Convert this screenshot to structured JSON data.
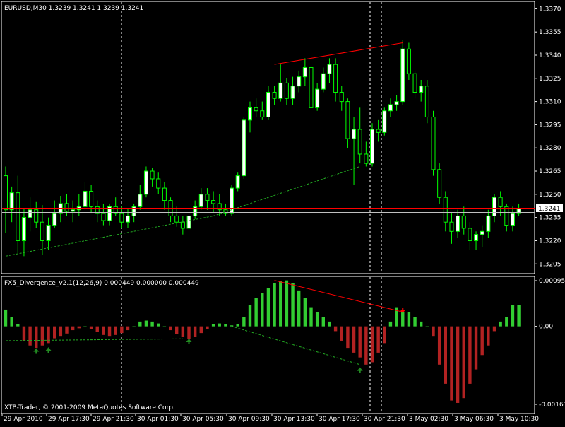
{
  "main_label": "EURUSD,M30  1.3239 1.3241 1.3239 1.3241",
  "indicator_label": "FX5_Divergence_v2.1(12,26,9) 0.000449 0.000000 0.000449",
  "copyright": "XTB-Trader, © 2001-2009 MetaQuotes Software Corp.",
  "current_price_label": "1.3241",
  "colors": {
    "background": "#000000",
    "frame": "#ffffff",
    "bull_candle": "#ffffff",
    "bear_candle": "#000000",
    "wick": "#00ff00",
    "price_line": "#ff0000",
    "hist_up": "#32cd32",
    "hist_down": "#b22222",
    "divergence_line_bear": "#ff0000",
    "divergence_line_bull": "#22aa22",
    "arrow_up": "#228b22",
    "arrow_down": "#ff0000",
    "text": "#ffffff"
  },
  "chart_data": [
    {
      "type": "candlestick",
      "symbol": "EURUSD",
      "timeframe": "M30",
      "ylim": [
        1.3201,
        1.3372
      ],
      "y_ticks": [
        "1.3370",
        "1.3355",
        "1.3340",
        "1.3325",
        "1.3310",
        "1.3295",
        "1.3280",
        "1.3265",
        "1.3250",
        "1.3235",
        "1.3220",
        "1.3205"
      ],
      "x_ticks": [
        "29 Apr 2010",
        "29 Apr 17:30",
        "29 Apr 21:30",
        "30 Apr 01:30",
        "30 Apr 05:30",
        "30 Apr 09:30",
        "30 Apr 13:30",
        "30 Apr 17:30",
        "30 Apr 21:30",
        "3 May 02:30",
        "3 May 06:30",
        "3 May 10:30"
      ],
      "current_price": 1.3241,
      "ohlc": [
        [
          1.3262,
          1.3268,
          1.3225,
          1.324
        ],
        [
          1.324,
          1.3255,
          1.3232,
          1.3251
        ],
        [
          1.3251,
          1.3262,
          1.3212,
          1.322
        ],
        [
          1.322,
          1.3241,
          1.321,
          1.3235
        ],
        [
          1.3235,
          1.3248,
          1.3226,
          1.324
        ],
        [
          1.324,
          1.3245,
          1.3228,
          1.3232
        ],
        [
          1.3232,
          1.3243,
          1.3211,
          1.322
        ],
        [
          1.322,
          1.3235,
          1.3214,
          1.323
        ],
        [
          1.323,
          1.3246,
          1.3228,
          1.3238
        ],
        [
          1.3238,
          1.3249,
          1.3232,
          1.3244
        ],
        [
          1.3244,
          1.325,
          1.3236,
          1.3239
        ],
        [
          1.3239,
          1.3246,
          1.3232,
          1.324
        ],
        [
          1.324,
          1.325,
          1.3236,
          1.3242
        ],
        [
          1.3242,
          1.3258,
          1.324,
          1.3252
        ],
        [
          1.3252,
          1.3256,
          1.3238,
          1.3242
        ],
        [
          1.3242,
          1.3246,
          1.3232,
          1.3238
        ],
        [
          1.3238,
          1.3244,
          1.323,
          1.3233
        ],
        [
          1.3233,
          1.3244,
          1.323,
          1.3242
        ],
        [
          1.3242,
          1.3248,
          1.3236,
          1.3238
        ],
        [
          1.3238,
          1.3242,
          1.3228,
          1.3232
        ],
        [
          1.3232,
          1.3241,
          1.3228,
          1.3236
        ],
        [
          1.3236,
          1.3244,
          1.3232,
          1.3242
        ],
        [
          1.3242,
          1.3256,
          1.324,
          1.325
        ],
        [
          1.325,
          1.3268,
          1.3248,
          1.3265
        ],
        [
          1.3265,
          1.3267,
          1.3255,
          1.326
        ],
        [
          1.326,
          1.3264,
          1.325,
          1.3254
        ],
        [
          1.3254,
          1.3258,
          1.324,
          1.3246
        ],
        [
          1.3246,
          1.3248,
          1.3232,
          1.3236
        ],
        [
          1.3236,
          1.3242,
          1.3229,
          1.3232
        ],
        [
          1.3232,
          1.3236,
          1.3224,
          1.3228
        ],
        [
          1.3228,
          1.3238,
          1.3226,
          1.3236
        ],
        [
          1.3236,
          1.3246,
          1.3234,
          1.3242
        ],
        [
          1.3242,
          1.3254,
          1.324,
          1.325
        ],
        [
          1.325,
          1.3254,
          1.324,
          1.3246
        ],
        [
          1.3246,
          1.3252,
          1.3238,
          1.3244
        ],
        [
          1.3244,
          1.325,
          1.3236,
          1.324
        ],
        [
          1.324,
          1.3244,
          1.3236,
          1.3238
        ],
        [
          1.3238,
          1.3256,
          1.3236,
          1.3254
        ],
        [
          1.3254,
          1.3264,
          1.3252,
          1.3262
        ],
        [
          1.3262,
          1.33,
          1.326,
          1.3298
        ],
        [
          1.3298,
          1.331,
          1.329,
          1.3306
        ],
        [
          1.3306,
          1.3312,
          1.33,
          1.3304
        ],
        [
          1.3304,
          1.331,
          1.3298,
          1.33
        ],
        [
          1.33,
          1.332,
          1.3298,
          1.3316
        ],
        [
          1.3316,
          1.332,
          1.3308,
          1.3312
        ],
        [
          1.3312,
          1.3334,
          1.331,
          1.3322
        ],
        [
          1.3322,
          1.3325,
          1.3308,
          1.3312
        ],
        [
          1.3312,
          1.3326,
          1.3308,
          1.332
        ],
        [
          1.332,
          1.333,
          1.3316,
          1.3326
        ],
        [
          1.3326,
          1.3338,
          1.332,
          1.3332
        ],
        [
          1.3332,
          1.3336,
          1.33,
          1.3306
        ],
        [
          1.3306,
          1.3322,
          1.3304,
          1.3318
        ],
        [
          1.3318,
          1.3332,
          1.3316,
          1.3328
        ],
        [
          1.3328,
          1.3338,
          1.3322,
          1.3334
        ],
        [
          1.3334,
          1.3338,
          1.331,
          1.3316
        ],
        [
          1.3316,
          1.332,
          1.3304,
          1.331
        ],
        [
          1.331,
          1.3312,
          1.328,
          1.3286
        ],
        [
          1.3286,
          1.33,
          1.3256,
          1.3292
        ],
        [
          1.3292,
          1.3306,
          1.327,
          1.3276
        ],
        [
          1.3276,
          1.3284,
          1.3268,
          1.327
        ],
        [
          1.327,
          1.3296,
          1.3268,
          1.3292
        ],
        [
          1.3292,
          1.3298,
          1.3284,
          1.329
        ],
        [
          1.329,
          1.3306,
          1.3288,
          1.3304
        ],
        [
          1.3304,
          1.3312,
          1.33,
          1.3308
        ],
        [
          1.3308,
          1.3314,
          1.3304,
          1.331
        ],
        [
          1.331,
          1.335,
          1.3308,
          1.3344
        ],
        [
          1.3344,
          1.3348,
          1.3324,
          1.3328
        ],
        [
          1.3328,
          1.333,
          1.3312,
          1.3316
        ],
        [
          1.3316,
          1.3324,
          1.331,
          1.332
        ],
        [
          1.332,
          1.3324,
          1.3296,
          1.33
        ],
        [
          1.33,
          1.3304,
          1.3262,
          1.3266
        ],
        [
          1.3266,
          1.327,
          1.3244,
          1.3248
        ],
        [
          1.3248,
          1.3252,
          1.3226,
          1.3232
        ],
        [
          1.3232,
          1.3238,
          1.3218,
          1.3226
        ],
        [
          1.3226,
          1.324,
          1.3222,
          1.3236
        ],
        [
          1.3236,
          1.3242,
          1.3224,
          1.3228
        ],
        [
          1.3228,
          1.3232,
          1.3214,
          1.322
        ],
        [
          1.322,
          1.3226,
          1.3214,
          1.3224
        ],
        [
          1.3224,
          1.323,
          1.3216,
          1.3226
        ],
        [
          1.3226,
          1.324,
          1.3222,
          1.3236
        ],
        [
          1.3236,
          1.325,
          1.3232,
          1.3248
        ],
        [
          1.3248,
          1.3252,
          1.3236,
          1.3242
        ],
        [
          1.3242,
          1.3244,
          1.3226,
          1.323
        ],
        [
          1.323,
          1.3242,
          1.3226,
          1.3238
        ],
        [
          1.3238,
          1.3244,
          1.3236,
          1.3241
        ]
      ],
      "divergence_lines": [
        {
          "style": "solid",
          "color": "#ff0000",
          "from": [
            44,
            1.3334
          ],
          "to": [
            65,
            1.3348
          ]
        },
        {
          "style": "dashed",
          "color": "#22aa22",
          "from": [
            0,
            1.321
          ],
          "to": [
            34,
            1.3236
          ]
        },
        {
          "style": "dashed",
          "color": "#22aa22",
          "from": [
            34,
            1.3236
          ],
          "to": [
            58,
            1.3268
          ]
        }
      ]
    },
    {
      "type": "histogram",
      "name": "FX5_Divergence_v2.1(12,26,9)",
      "ylim": [
        -0.00163,
        0.000955
      ],
      "y_ticks": [
        "0.000955",
        "0.00",
        "-0.00163"
      ],
      "values": [
        0.00035,
        0.0002,
        5e-05,
        -0.0003,
        -0.0004,
        -0.00045,
        -0.0004,
        -0.00035,
        -0.00025,
        -0.0002,
        -0.00015,
        -8e-05,
        -4e-05,
        0.0,
        -6e-05,
        -0.00012,
        -0.00018,
        -0.0002,
        -0.00018,
        -0.00014,
        -8e-05,
        0.0,
        0.0001,
        0.00012,
        0.0001,
        6e-05,
        0.0,
        -8e-05,
        -0.00016,
        -0.00022,
        -0.00026,
        -0.00022,
        -0.00014,
        -6e-05,
        4e-05,
        6e-05,
        4e-05,
        2e-05,
        5e-05,
        0.0002,
        0.00045,
        0.0006,
        0.0007,
        0.0008,
        0.0009,
        0.00095,
        0.00096,
        0.0009,
        0.00075,
        0.0006,
        0.0004,
        0.0003,
        0.0002,
        0.0001,
        -0.0001,
        -0.0003,
        -0.00045,
        -0.00055,
        -0.00065,
        -0.0008,
        -0.00075,
        -0.00055,
        -0.00035,
        0.0001,
        0.0004,
        0.0003,
        0.0003,
        0.0002,
        0.0001,
        0.0,
        -0.0002,
        -0.0008,
        -0.0012,
        -0.00155,
        -0.0016,
        -0.0015,
        -0.0012,
        -0.0009,
        -0.0006,
        -0.0004,
        -0.0001,
        0.0001,
        0.0002,
        0.00045,
        0.00045
      ],
      "divergence_lines": [
        {
          "style": "solid",
          "color": "#ff0000",
          "from": [
            44,
            0.00096
          ],
          "to": [
            65,
            0.0003
          ]
        },
        {
          "style": "dashed",
          "color": "#22aa22",
          "from": [
            0,
            -0.0003
          ],
          "to": [
            29,
            -0.00026
          ]
        },
        {
          "style": "dashed",
          "color": "#22aa22",
          "from": [
            37,
            0.0
          ],
          "to": [
            58,
            -0.0008
          ]
        }
      ],
      "arrows": [
        {
          "dir": "up",
          "color": "#228b22",
          "index": 5,
          "value": -0.0005
        },
        {
          "dir": "up",
          "color": "#228b22",
          "index": 7,
          "value": -0.00048
        },
        {
          "dir": "up",
          "color": "#228b22",
          "index": 30,
          "value": -0.0003
        },
        {
          "dir": "up",
          "color": "#228b22",
          "index": 58,
          "value": -0.0009
        },
        {
          "dir": "down",
          "color": "#ff0000",
          "index": 65,
          "value": 0.00032
        }
      ]
    }
  ]
}
